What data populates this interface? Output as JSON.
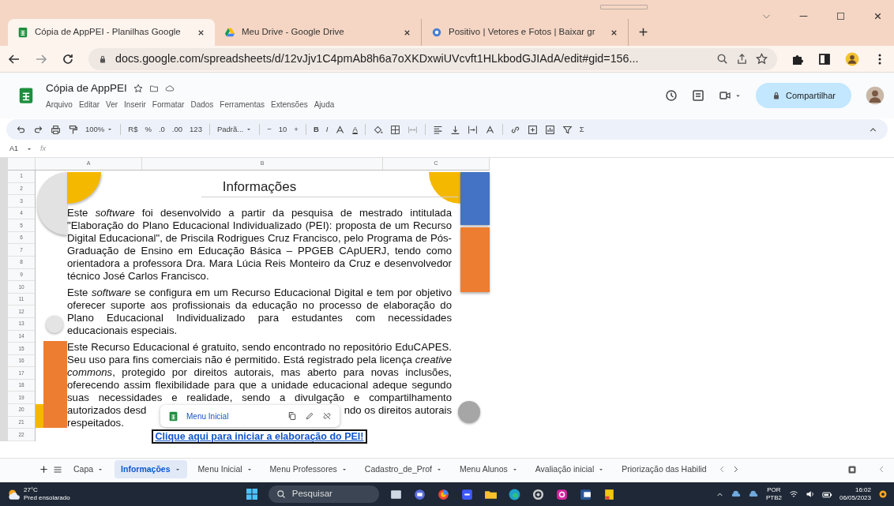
{
  "browser": {
    "tabs": [
      {
        "title": "Cópia de AppPEI - Planilhas Google",
        "selected": true
      },
      {
        "title": "Meu Drive - Google Drive",
        "selected": false
      },
      {
        "title": "Positivo | Vetores e Fotos | Baixar gr",
        "selected": false
      }
    ],
    "url": "docs.google.com/spreadsheets/d/12vJjv1C4pmAb8h6a7oXKDxwiUVcvft1HLkbodGJIAdA/edit#gid=156..."
  },
  "sheets": {
    "title": "Cópia de AppPEI",
    "menus": [
      "Arquivo",
      "Editar",
      "Ver",
      "Inserir",
      "Formatar",
      "Dados",
      "Ferramentas",
      "Extensões",
      "Ajuda"
    ],
    "share_label": "Compartilhar",
    "toolbar": {
      "zoom": "100%",
      "currency": "R$",
      "percent": "%",
      "decimal_decrease": ".0",
      "decimal_increase": ".00",
      "number_format": "123",
      "font": "Padrã...",
      "size_decrease": "−",
      "font_size": "10",
      "size_increase": "+",
      "bold": "B",
      "italic": "I",
      "text_color": "A",
      "functions": "Σ"
    },
    "cell_ref": "A1",
    "fx": "fx",
    "columns": [
      "A",
      "B",
      "C"
    ],
    "rows": [
      "1",
      "2",
      "3",
      "4",
      "5",
      "6",
      "7",
      "8",
      "9",
      "10",
      "11",
      "12",
      "13",
      "14",
      "15",
      "16",
      "17",
      "18",
      "19",
      "20",
      "21",
      "22"
    ],
    "content": {
      "heading": "Informações",
      "paragraphs": [
        "Este *software* foi desenvolvido a partir da pesquisa de mestrado intitulada \"Elaboração do Plano Educacional Individualizado (PEI): proposta de um Recurso Digital Educacional\", de Priscila Rodrigues Cruz Francisco, pelo Programa de Pós-Graduação de Ensino em Educação Básica – PPGEB CApUERJ, tendo como orientadora a professora Dra. Mara Lúcia Reis Monteiro da Cruz e desenvolvedor técnico José Carlos Francisco.",
        "Este *software* se configura em um Recurso Educacional Digital e tem por objetivo oferecer suporte aos profissionais da educação no processo de elaboração do Plano Educacional Individualizado para estudantes com necessidades educacionais especiais.",
        "Este Recurso Educacional é gratuito, sendo encontrado no repositório EduCAPES. Seu uso para fins comerciais não é permitido. Está registrado pela licença *creative commons*, protegido por direitos autorais, mas aberto para novas inclusões, oferecendo assim flexibilidade para que a unidade educacional adeque segundo suas necessidades e realidade, sendo a divulgação e compartilhamento"
      ],
      "covered_line_left": "autorizados desd",
      "covered_line_right": "ndo os direitos autorais",
      "last_line": "respeitados.",
      "link": "Clique aqui para iniciar a elaboração do PEI!",
      "link_chip": "Menu Inicial"
    },
    "sheet_tabs": [
      {
        "label": "Capa",
        "selected": false
      },
      {
        "label": "Informações",
        "selected": true
      },
      {
        "label": "Menu Inicial",
        "selected": false
      },
      {
        "label": "Menu Professores",
        "selected": false
      },
      {
        "label": "Cadastro_de_Prof",
        "selected": false
      },
      {
        "label": "Menu Alunos",
        "selected": false
      },
      {
        "label": "Avaliação inicial",
        "selected": false
      },
      {
        "label": "Priorização das Habilid",
        "selected": false
      }
    ]
  },
  "taskbar": {
    "temperature": "27°C",
    "weather": "Pred ensolarado",
    "search": "Pesquisar",
    "language": "POR",
    "layout": "PTB2",
    "time": "16:02",
    "date": "06/05/2023"
  }
}
